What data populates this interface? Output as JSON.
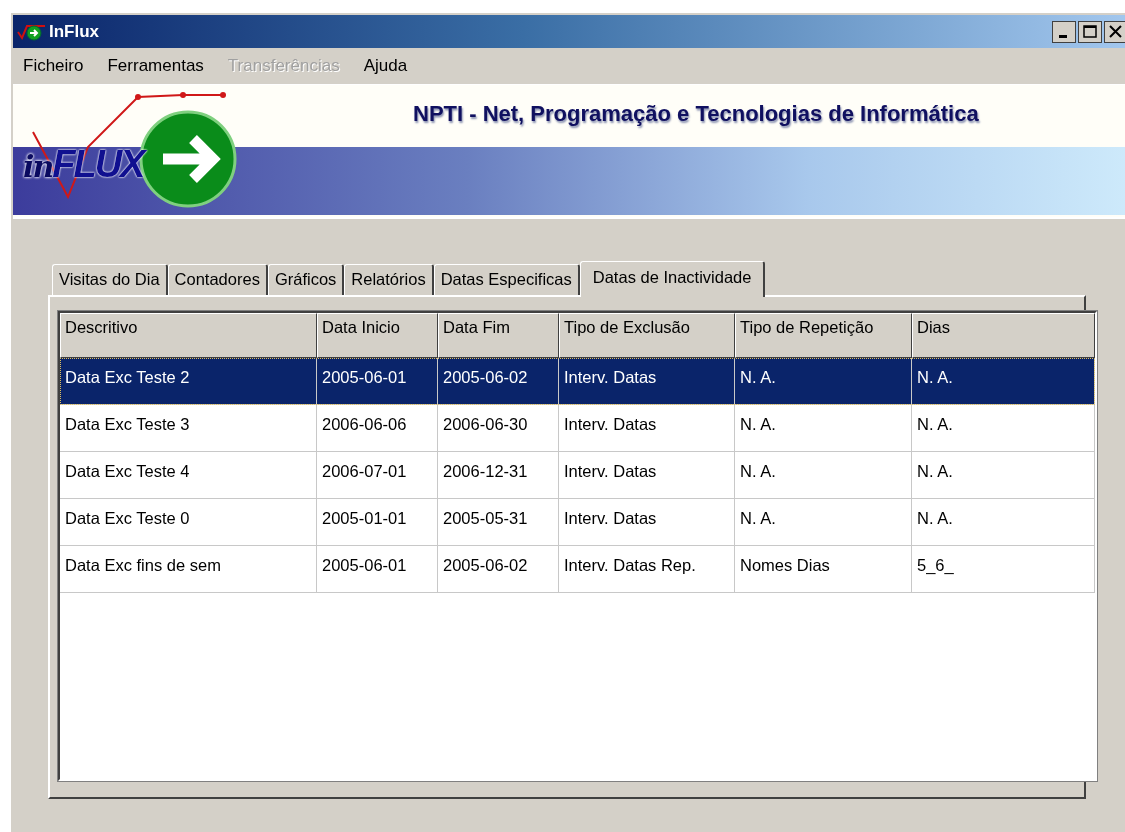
{
  "window": {
    "title": "InFlux"
  },
  "menu": [
    {
      "label": "Ficheiro",
      "disabled": false
    },
    {
      "label": "Ferramentas",
      "disabled": false
    },
    {
      "label": "Transferências",
      "disabled": true
    },
    {
      "label": "Ajuda",
      "disabled": false
    }
  ],
  "banner": {
    "logo_prefix": "in",
    "logo_main": "FLUX",
    "company": "NPTI - Net, Programação e Tecnologias de Informática"
  },
  "tabs": [
    {
      "label": "Visitas do Dia",
      "selected": false
    },
    {
      "label": "Contadores",
      "selected": false
    },
    {
      "label": "Gráficos",
      "selected": false
    },
    {
      "label": "Relatórios",
      "selected": false
    },
    {
      "label": "Datas Especificas",
      "selected": false
    },
    {
      "label": "Datas de Inactividade",
      "selected": true
    }
  ],
  "table": {
    "columns": [
      "Descritivo",
      "Data Inicio",
      "Data Fim",
      "Tipo de Exclusão",
      "Tipo de Repetição",
      "Dias"
    ],
    "rows": [
      {
        "cells": [
          "Data Exc Teste 2",
          "2005-06-01",
          "2005-06-02",
          "Interv. Datas",
          "N. A.",
          "N. A."
        ],
        "selected": true
      },
      {
        "cells": [
          "Data Exc Teste 3",
          "2006-06-06",
          "2006-06-30",
          "Interv. Datas",
          "N. A.",
          "N. A."
        ],
        "selected": false
      },
      {
        "cells": [
          "Data Exc Teste 4",
          "2006-07-01",
          "2006-12-31",
          "Interv. Datas",
          "N. A.",
          "N. A."
        ],
        "selected": false
      },
      {
        "cells": [
          "Data Exc Teste 0",
          "2005-01-01",
          "2005-05-31",
          "Interv. Datas",
          "N. A.",
          "N. A."
        ],
        "selected": false
      },
      {
        "cells": [
          "Data Exc fins de sem",
          "2005-06-01",
          "2005-06-02",
          "Interv. Datas Rep.",
          "Nomes Dias",
          "5_6_"
        ],
        "selected": false
      }
    ]
  }
}
